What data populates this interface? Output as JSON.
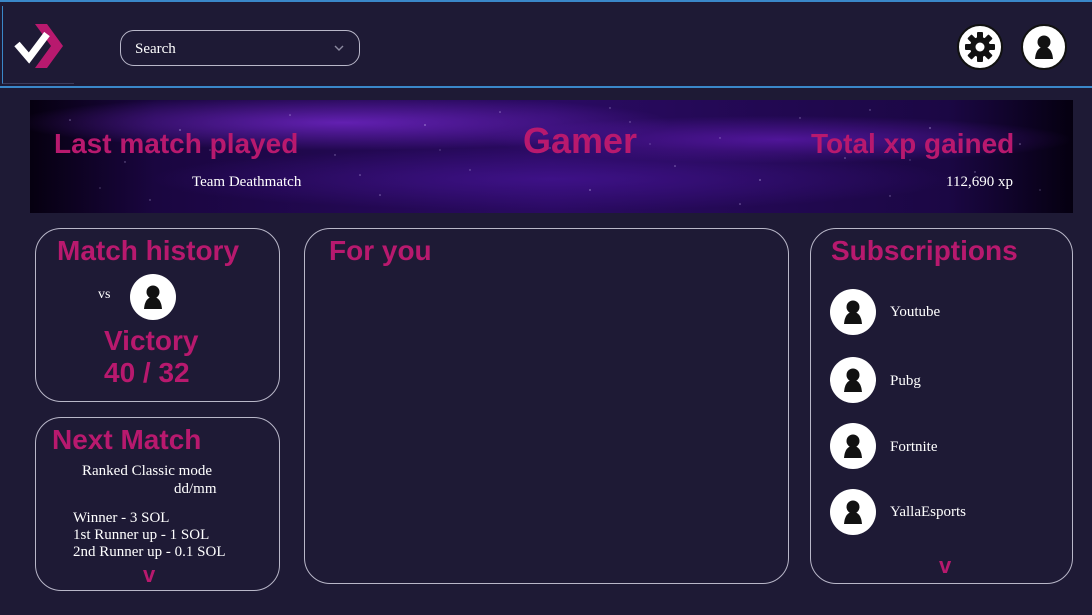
{
  "header": {
    "search": {
      "placeholder": "Search"
    }
  },
  "banner": {
    "left_title": "Last match played",
    "left_value": "Team Deathmatch",
    "center_title": "Gamer",
    "right_title": "Total xp gained",
    "right_value": "112,690 xp"
  },
  "match_history": {
    "title": "Match history",
    "vs_label": "vs",
    "result": "Victory",
    "score": "40 / 32"
  },
  "next_match": {
    "title": "Next Match",
    "mode": "Ranked Classic mode",
    "date": "dd/mm",
    "prizes": [
      "Winner - 3 SOL",
      "1st Runner up - 1 SOL",
      "2nd Runner up - 0.1 SOL"
    ],
    "more": "v"
  },
  "for_you": {
    "title": "For you"
  },
  "subscriptions": {
    "title": "Subscriptions",
    "items": [
      "Youtube",
      "Pubg",
      "Fortnite",
      "YallaEsports"
    ],
    "more": "v"
  },
  "colors": {
    "background": "#1e1a35",
    "accent": "#b8196e",
    "topbar_border": "#3a87c9",
    "card_border": "#b9b7c9"
  },
  "icons": [
    "logo-icon",
    "chevron-down-icon",
    "gear-icon",
    "user-icon"
  ]
}
